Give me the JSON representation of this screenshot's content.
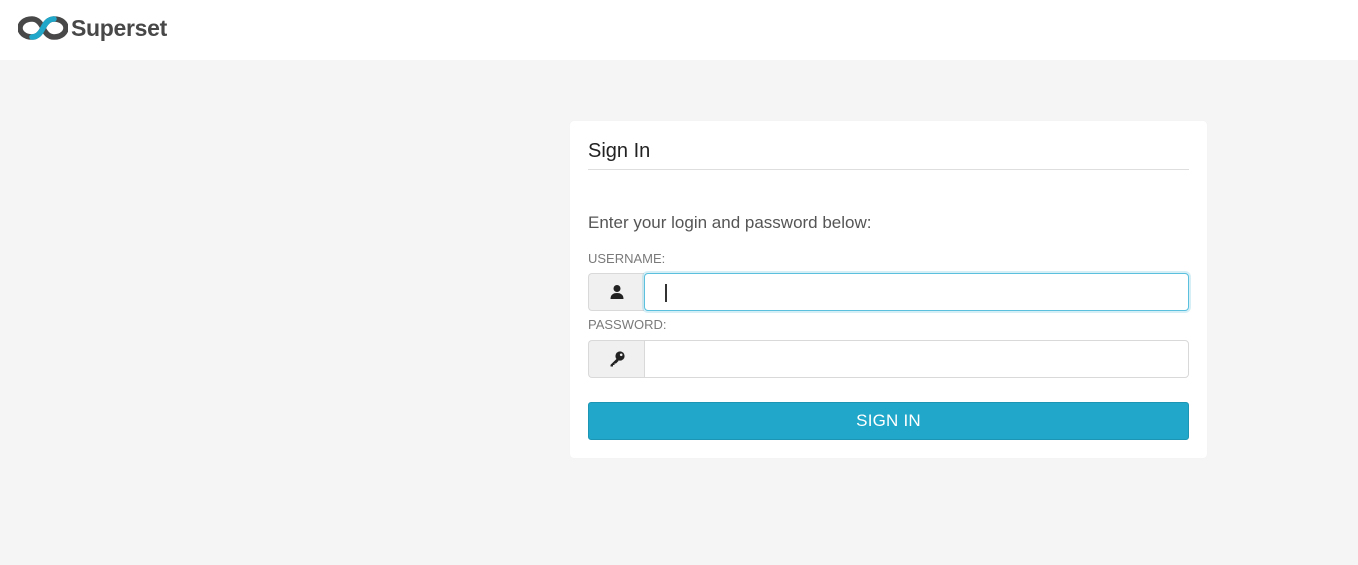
{
  "app": {
    "brand_name": "Superset",
    "brand_colors": {
      "dark": "#484848",
      "accent": "#20a7c9"
    }
  },
  "login": {
    "title": "Sign In",
    "instructions": "Enter your login and password below:",
    "username_label": "USERNAME:",
    "username_value": "",
    "username_icon": "user-icon",
    "password_label": "PASSWORD:",
    "password_value": "",
    "password_icon": "key-icon",
    "submit_label": "SIGN IN",
    "submit_color": "#20a7c9",
    "focused_field": "username"
  }
}
